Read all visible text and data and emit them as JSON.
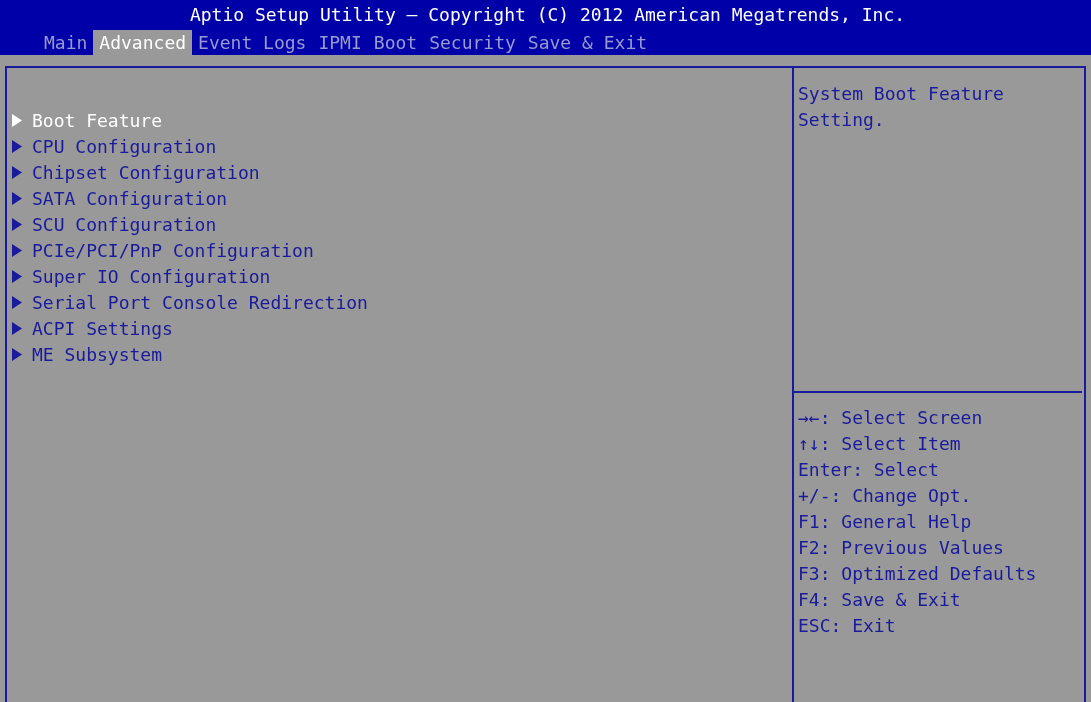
{
  "header": {
    "title": "Aptio Setup Utility – Copyright (C) 2012 American Megatrends, Inc."
  },
  "tabs": [
    {
      "label": "Main",
      "selected": false
    },
    {
      "label": "Advanced",
      "selected": true
    },
    {
      "label": "Event Logs",
      "selected": false
    },
    {
      "label": "IPMI",
      "selected": false
    },
    {
      "label": "Boot",
      "selected": false
    },
    {
      "label": "Security",
      "selected": false
    },
    {
      "label": "Save & Exit",
      "selected": false
    }
  ],
  "menu": [
    {
      "label": "Boot Feature",
      "selected": true
    },
    {
      "label": "CPU Configuration",
      "selected": false
    },
    {
      "label": "Chipset Configuration",
      "selected": false
    },
    {
      "label": "SATA Configuration",
      "selected": false
    },
    {
      "label": "SCU Configuration",
      "selected": false
    },
    {
      "label": "PCIe/PCI/PnP Configuration",
      "selected": false
    },
    {
      "label": "Super IO Configuration",
      "selected": false
    },
    {
      "label": "Serial Port Console Redirection",
      "selected": false
    },
    {
      "label": "ACPI Settings",
      "selected": false
    },
    {
      "label": "ME Subsystem",
      "selected": false
    }
  ],
  "help_text": "System Boot Feature Setting.",
  "key_help": [
    "→←: Select Screen",
    "↑↓: Select Item",
    "Enter: Select",
    "+/-: Change Opt.",
    "F1: General Help",
    "F2: Previous Values",
    "F3: Optimized Defaults",
    "F4: Save & Exit",
    "ESC: Exit"
  ]
}
